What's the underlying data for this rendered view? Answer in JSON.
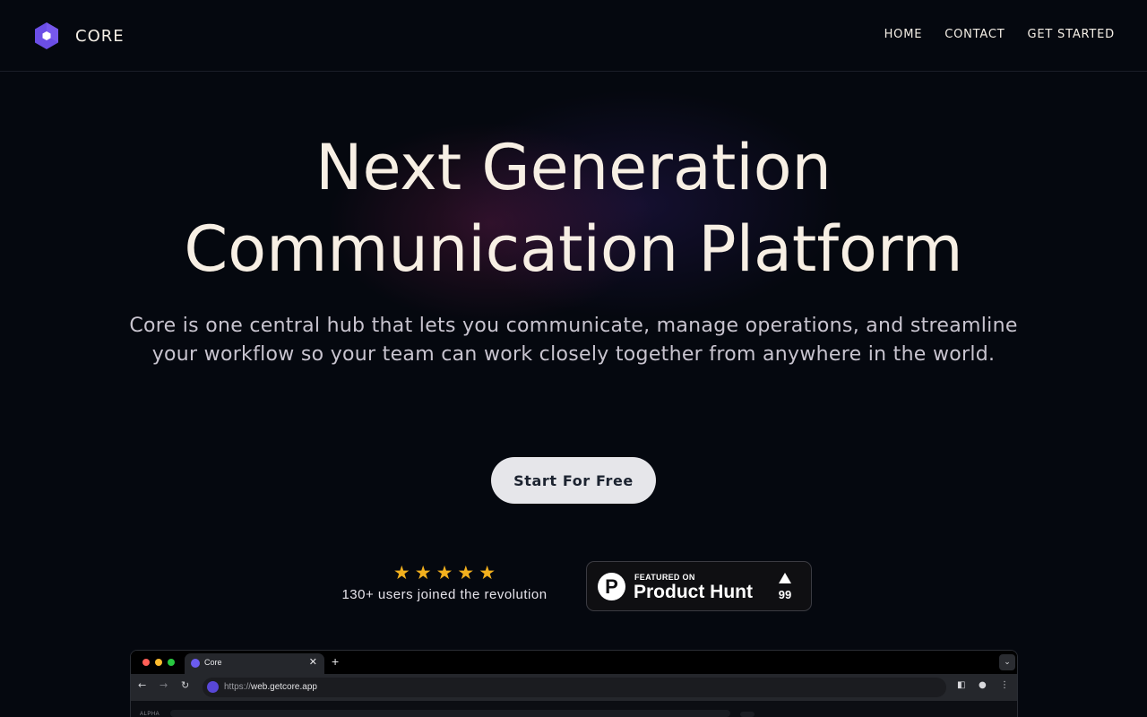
{
  "nav": {
    "brand": "CORE",
    "links": [
      "HOME",
      "CONTACT",
      "GET STARTED"
    ]
  },
  "hero": {
    "title_line1": "Next Generation",
    "title_line2": "Communication Platform",
    "subtitle": "Core is one central hub that lets you communicate, manage operations, and streamline your workflow so your team can work closely together from anywhere in the world.",
    "cta_label": "Start For Free"
  },
  "rating": {
    "stars": 5,
    "text": "130+ users joined the revolution"
  },
  "product_hunt": {
    "featured": "FEATURED ON",
    "name": "Product Hunt",
    "logo_letter": "P",
    "votes": "99"
  },
  "browser": {
    "tab_title": "Core",
    "url_protocol": "https://",
    "url_host": "web.getcore.app",
    "sidebar_label": "ALPHA"
  },
  "colors": {
    "background": "#05080f",
    "logo": "#6b4ee6",
    "star": "#f2b01e",
    "cta_bg": "#e6e6ea"
  },
  "icons": [
    "hexagon-logo-icon",
    "star-icon",
    "product-hunt-logo-icon",
    "upvote-arrow-icon",
    "back-arrow-icon",
    "forward-arrow-icon",
    "reload-icon",
    "sidebar-icon",
    "profile-icon",
    "kebab-menu-icon"
  ]
}
